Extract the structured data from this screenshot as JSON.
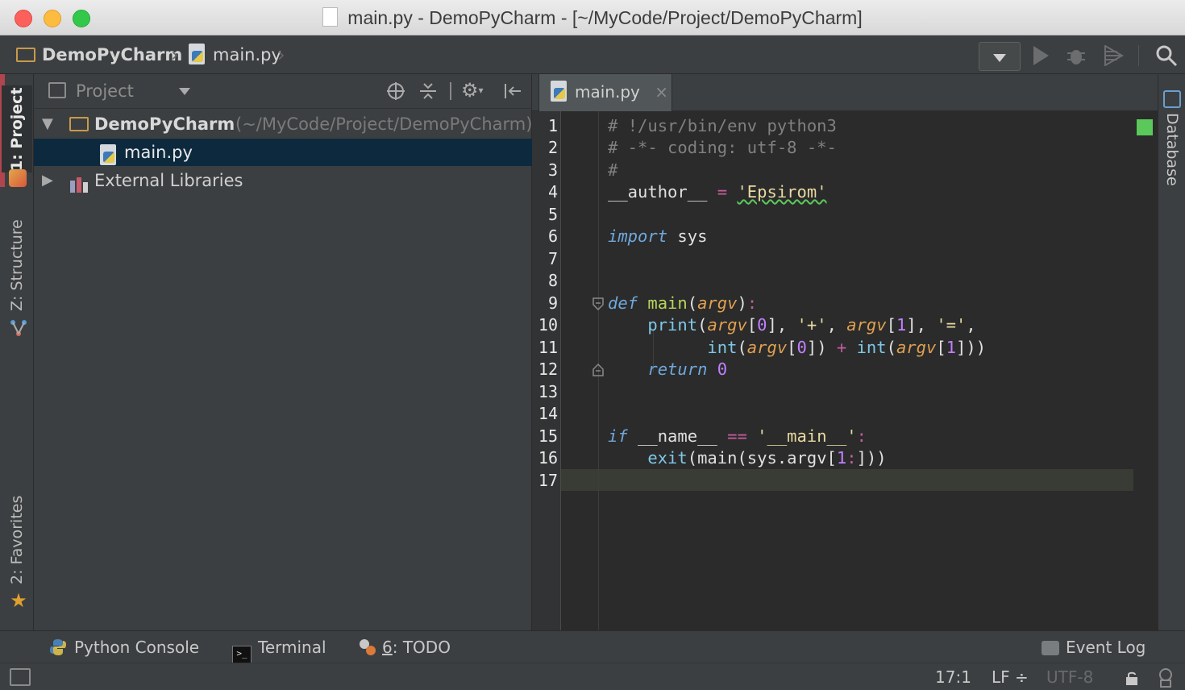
{
  "window": {
    "title": "main.py - DemoPyCharm - [~/MyCode/Project/DemoPyCharm]"
  },
  "navbar": {
    "project_crumb": "DemoPyCharm",
    "file_crumb": "main.py"
  },
  "left_tabs": {
    "project": "1: Project",
    "structure": "Z: Structure",
    "favorites": "2: Favorites"
  },
  "project_panel": {
    "view_selector": "Project",
    "root_name": "DemoPyCharm",
    "root_path": "(~/MyCode/Project/DemoPyCharm)",
    "file_item": "main.py",
    "libraries": "External Libraries"
  },
  "editor": {
    "tab_label": "main.py",
    "tab_close": "×",
    "line_numbers": [
      "1",
      "2",
      "3",
      "4",
      "5",
      "6",
      "7",
      "8",
      "9",
      "10",
      "11",
      "12",
      "13",
      "14",
      "15",
      "16",
      "17"
    ]
  },
  "right_tabs": {
    "database": "Database"
  },
  "bottom_tools": {
    "python_console": "Python Console",
    "terminal": "Terminal",
    "todo_prefix": "6",
    "todo_label": ": TODO",
    "event_log": "Event Log"
  },
  "status": {
    "caret": "17:1",
    "line_sep": "LF ÷",
    "encoding": "UTF-8"
  },
  "colors": {
    "editor_bg": "#2b2b2b",
    "panel_bg": "#3c3f41",
    "selection": "#0d293e",
    "current_line": "#323232",
    "status_ok": "#5ac85a"
  }
}
